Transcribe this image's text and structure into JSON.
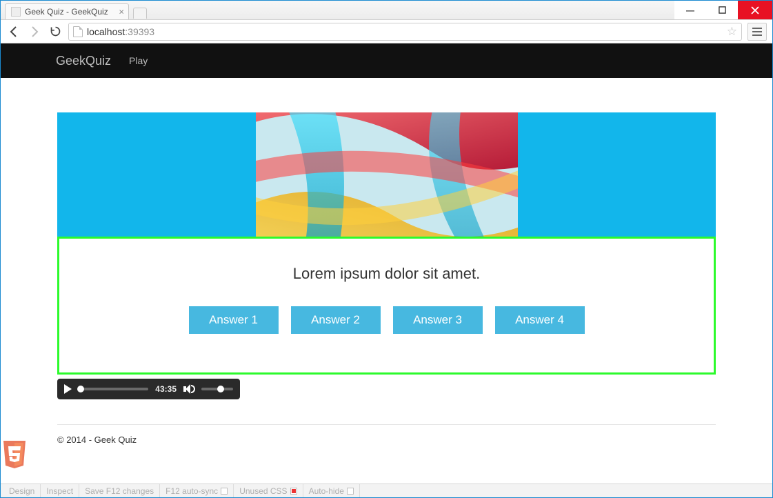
{
  "window": {
    "tab_title": "Geek Quiz - GeekQuiz",
    "tab_close_glyph": "×"
  },
  "browser": {
    "url_host": "localhost",
    "url_path": ":39393",
    "star_glyph": "☆"
  },
  "site": {
    "brand": "GeekQuiz",
    "nav": {
      "play": "Play"
    }
  },
  "quiz": {
    "question": "Lorem ipsum dolor sit amet.",
    "answers": [
      "Answer 1",
      "Answer 2",
      "Answer 3",
      "Answer 4"
    ]
  },
  "media": {
    "time": "43:35"
  },
  "footer": {
    "copyright": "© 2014 - Geek Quiz"
  },
  "statusbar": {
    "items": {
      "design": "Design",
      "inspect": "Inspect",
      "save_f12": "Save F12 changes",
      "f12_autosync": "F12 auto-sync",
      "unused_css": "Unused CSS",
      "auto_hide": "Auto-hide"
    }
  }
}
